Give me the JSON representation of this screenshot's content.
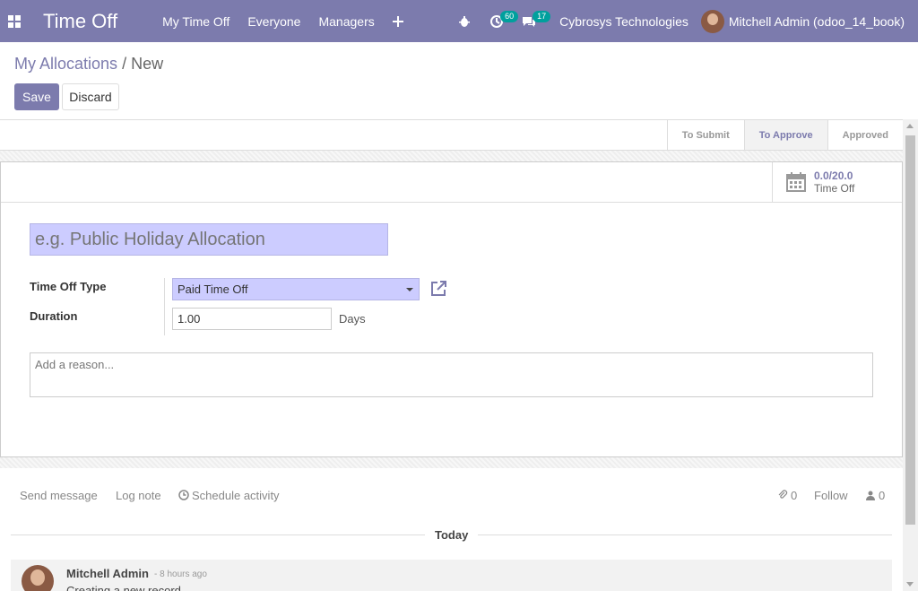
{
  "navbar": {
    "app_title": "Time Off",
    "menu": [
      "My Time Off",
      "Everyone",
      "Managers"
    ],
    "activity_count": "60",
    "message_count": "17",
    "company": "Cybrosys Technologies",
    "user": "Mitchell Admin (odoo_14_book)"
  },
  "breadcrumb": {
    "parent": "My Allocations",
    "separator": "/",
    "current": "New"
  },
  "buttons": {
    "save": "Save",
    "discard": "Discard"
  },
  "status_stages": [
    "To Submit",
    "To Approve",
    "Approved"
  ],
  "active_stage": "To Approve",
  "stat_button": {
    "value": "0.0/20.0",
    "label": "Time Off"
  },
  "form": {
    "name_placeholder": "e.g. Public Holiday Allocation",
    "time_off_type_label": "Time Off Type",
    "time_off_type_value": "Paid Time Off",
    "duration_label": "Duration",
    "duration_value": "1.00",
    "duration_unit": "Days",
    "reason_placeholder": "Add a reason..."
  },
  "chatter": {
    "send_message": "Send message",
    "log_note": "Log note",
    "schedule_activity": "Schedule activity",
    "attachments_count": "0",
    "follow": "Follow",
    "followers_count": "0",
    "date_separator": "Today",
    "message": {
      "author": "Mitchell Admin",
      "date": "- 8 hours ago",
      "body": "Creating a new record..."
    }
  },
  "colors": {
    "navbar": "#7c7bad",
    "accent": "#7c7bad",
    "required_field": "#ccccff",
    "badge": "#00a09d"
  }
}
